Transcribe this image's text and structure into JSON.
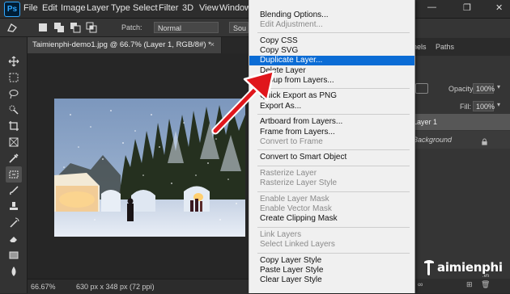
{
  "app": {
    "logo": "Ps"
  },
  "menubar": [
    "File",
    "Edit",
    "Image",
    "Layer",
    "Type",
    "Select",
    "Filter",
    "3D",
    "View",
    "Window"
  ],
  "window_controls": {
    "minimize": "—",
    "restore": "❐",
    "close": "✕"
  },
  "options_bar": {
    "patch_label": "Patch:",
    "patch_value": "Normal",
    "source_value": "Sou"
  },
  "document": {
    "tab_title": "Taimienphi-demo1.jpg @ 66.7% (Layer 1, RGB/8#) *",
    "close": "×",
    "zoom": "66.67%",
    "size_info": "630 px x 348 px (72 ppi)"
  },
  "right_panel": {
    "tabs": [
      "nels",
      "Paths"
    ],
    "opacity_label": "Opacity:",
    "opacity_value": "100%",
    "fill_label": "Fill:",
    "fill_value": "100%",
    "layers": [
      "Layer 1",
      "Background"
    ]
  },
  "context_menu": {
    "sections": [
      [
        {
          "label": "Blending Options...",
          "enabled": true
        },
        {
          "label": "Edit Adjustment...",
          "enabled": false
        }
      ],
      [
        {
          "label": "Copy CSS",
          "enabled": true
        },
        {
          "label": "Copy SVG",
          "enabled": true
        },
        {
          "label": "Duplicate Layer...",
          "enabled": true,
          "selected": true
        },
        {
          "label": "Delete Layer",
          "enabled": true
        },
        {
          "label": "Group from Layers...",
          "enabled": true
        }
      ],
      [
        {
          "label": "Quick Export as PNG",
          "enabled": true
        },
        {
          "label": "Export As...",
          "enabled": true
        }
      ],
      [
        {
          "label": "Artboard from Layers...",
          "enabled": true
        },
        {
          "label": "Frame from Layers...",
          "enabled": true
        },
        {
          "label": "Convert to Frame",
          "enabled": false
        }
      ],
      [
        {
          "label": "Convert to Smart Object",
          "enabled": true
        }
      ],
      [
        {
          "label": "Rasterize Layer",
          "enabled": false
        },
        {
          "label": "Rasterize Layer Style",
          "enabled": false
        }
      ],
      [
        {
          "label": "Enable Layer Mask",
          "enabled": false
        },
        {
          "label": "Enable Vector Mask",
          "enabled": false
        },
        {
          "label": "Create Clipping Mask",
          "enabled": true
        }
      ],
      [
        {
          "label": "Link Layers",
          "enabled": false
        },
        {
          "label": "Select Linked Layers",
          "enabled": false
        }
      ],
      [
        {
          "label": "Copy Layer Style",
          "enabled": true
        },
        {
          "label": "Paste Layer Style",
          "enabled": true
        },
        {
          "label": "Clear Layer Style",
          "enabled": true
        }
      ]
    ]
  },
  "watermark": {
    "text": "aimienphi",
    "sub": ".vn"
  },
  "colors": {
    "highlight": "#0b6cd5",
    "arrow": "#e0161c",
    "app_bg": "#282828"
  }
}
